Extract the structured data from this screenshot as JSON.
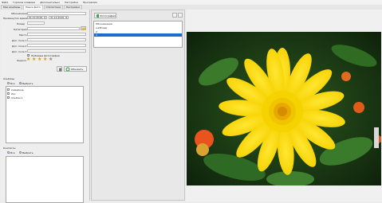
{
  "menu": [
    "Файл",
    "Горячие клавиши",
    "Дополнительно",
    "Настройки",
    "Программа"
  ],
  "tabs": [
    "Мои альбомы",
    "Поиск фото",
    "Статистика",
    "Настройки"
  ],
  "search": {
    "name_label": "Обозначение",
    "period_label": "Промежуток времени",
    "date_from": "01.12.2016",
    "date_to": "31.12.2016",
    "number_label": "Номер",
    "category_label": "Категория",
    "place_label": "Место",
    "extra1_label": "Доп. поле 1",
    "extra2_label": "Доп. поле 2",
    "extra3_label": "Доп. поле 3",
    "favorites_label": "Любимые фотографии",
    "rating_label": "Оценка",
    "rating_value": 4,
    "rating_max": 5,
    "update_button": "Обновить"
  },
  "albums": {
    "title": "Альбомы",
    "radio_all": "Все",
    "radio_selected": "Выбрать",
    "items": [
      "Семейное",
      "Лес",
      "Альбом 1"
    ]
  },
  "contacts": {
    "title": "Контакты",
    "radio_all": "Все",
    "radio_selected": "Выбрать"
  },
  "middle": {
    "photo_button": "Фотография",
    "list_items": [
      "Обозначение",
      "sunflower",
      "2",
      "3"
    ]
  },
  "colors": {
    "accent": "#2a6ad8",
    "selection": "#1c6ccc",
    "star": "#d59c14"
  }
}
